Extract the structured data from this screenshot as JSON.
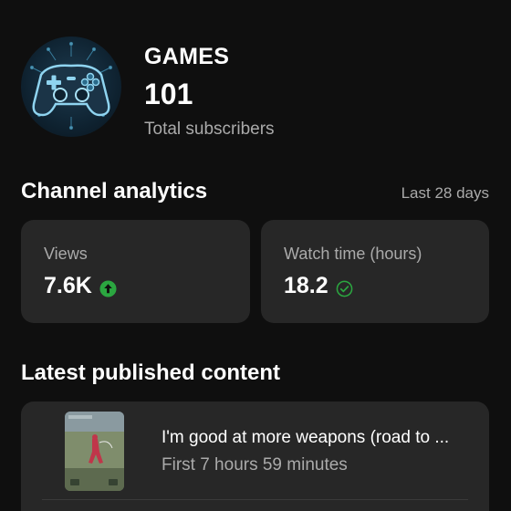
{
  "channel": {
    "name": "GAMES",
    "subscriber_count": "101",
    "subscriber_label": "Total subscribers"
  },
  "analytics": {
    "title": "Channel analytics",
    "period": "Last 28 days",
    "cards": [
      {
        "label": "Views",
        "value": "7.6K",
        "indicator": "up-arrow-icon",
        "indicator_color": "#2ba640"
      },
      {
        "label": "Watch time (hours)",
        "value": "18.2",
        "indicator": "check-circle-icon",
        "indicator_color": "#2ba640"
      }
    ]
  },
  "latest": {
    "title": "Latest published content",
    "video": {
      "title": "I'm good at more weapons (road to ...",
      "meta": "First 7 hours 59 minutes"
    }
  },
  "colors": {
    "background": "#0f0f0f",
    "card": "#272727",
    "secondary_text": "#aaaaaa",
    "positive": "#2ba640"
  }
}
